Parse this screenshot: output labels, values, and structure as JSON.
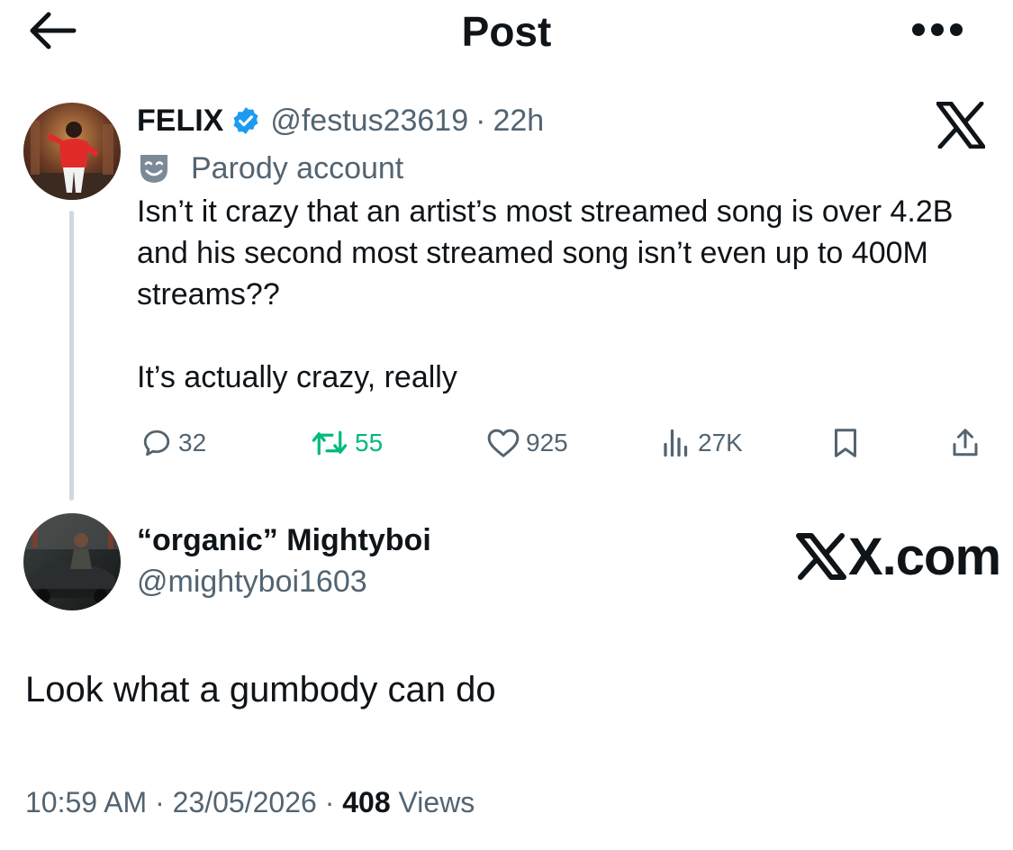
{
  "header": {
    "title": "Post",
    "back_icon": "arrow-left-icon",
    "more_icon": "more-horizontal-icon"
  },
  "quoted_post": {
    "author_name": "FELIX",
    "verified_icon": "verified-badge-icon",
    "handle": "@festus23619",
    "separator": "·",
    "time": "22h",
    "platform_icon": "x-logo-icon",
    "parody_label": "Parody account",
    "parody_icon": "theater-mask-icon",
    "text_paragraph_1": "Isn’t it crazy that an artist’s most streamed song is over 4.2B and his second most streamed song isn’t even up to 400M streams??",
    "text_paragraph_2": "It’s actually crazy, really",
    "stats": {
      "replies": "32",
      "reposts": "55",
      "likes": "925",
      "views": "27K"
    }
  },
  "reply_post": {
    "author_name": "“organic” Mightyboi",
    "handle": "@mightyboi1603",
    "watermark": "X.com",
    "text": "Look what a gumbody can do",
    "meta": {
      "time": "10:59 AM",
      "sep1": " · ",
      "date": "23/05/2026",
      "sep2": " · ",
      "views_count": "408",
      "views_label": " Views"
    }
  },
  "colors": {
    "text": "#0f1419",
    "muted": "#536471",
    "repost_green": "#00ba7c",
    "verified_blue": "#1d9bf0",
    "thread_line": "#cfd9de"
  }
}
